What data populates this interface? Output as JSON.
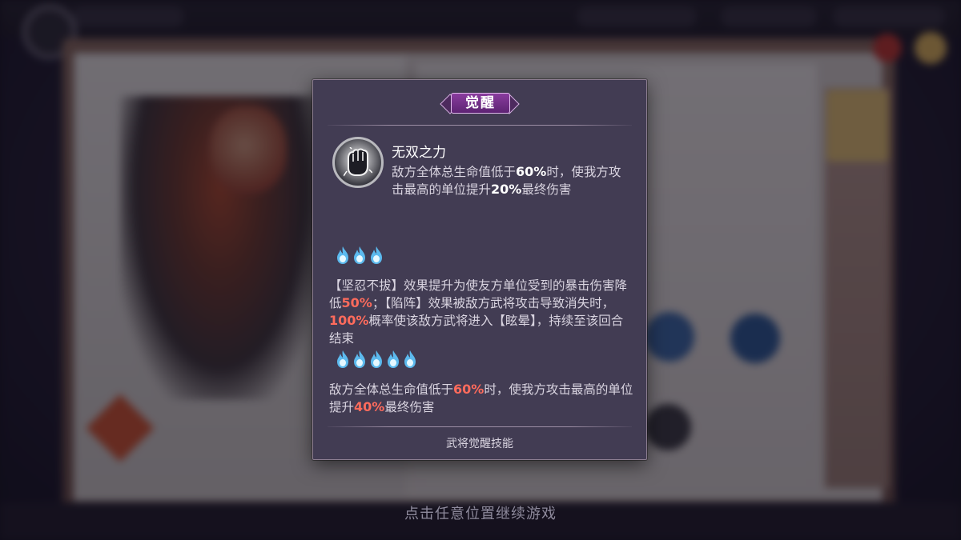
{
  "popup": {
    "title": "觉醒",
    "skill": {
      "name": "无双之力",
      "icon": "fist-icon",
      "desc_a": "敌方全体总生命值低于",
      "desc_v1": "60%",
      "desc_b": "时，使我方攻击最高的单位提升",
      "desc_v2": "20%",
      "desc_c": "最终伤害"
    },
    "tier3": {
      "flames": 3,
      "t1": "【坚忍不拔】效果提升为使友方单位受到的暴击伤害降低",
      "v1": "50%",
      "t2": "；【陷阵】效果被敌方武将攻击导致消失时，",
      "v2": "100%",
      "t3": "概率使该敌方武将进入【眩晕】，持续至该回合结束"
    },
    "tier5": {
      "flames": 5,
      "t1": "敌方全体总生命值低于",
      "v1": "60%",
      "t2": "时，使我方攻击最高的单位提升",
      "v2": "40%",
      "t3": "最终伤害"
    },
    "footer": "武将觉醒技能"
  },
  "hint": "点击任意位置继续游戏",
  "colors": {
    "highlight": "#ff6b5c",
    "flame": "#5fc8ff",
    "popup_bg": "#423c53",
    "title_badge": "#7a3490"
  }
}
